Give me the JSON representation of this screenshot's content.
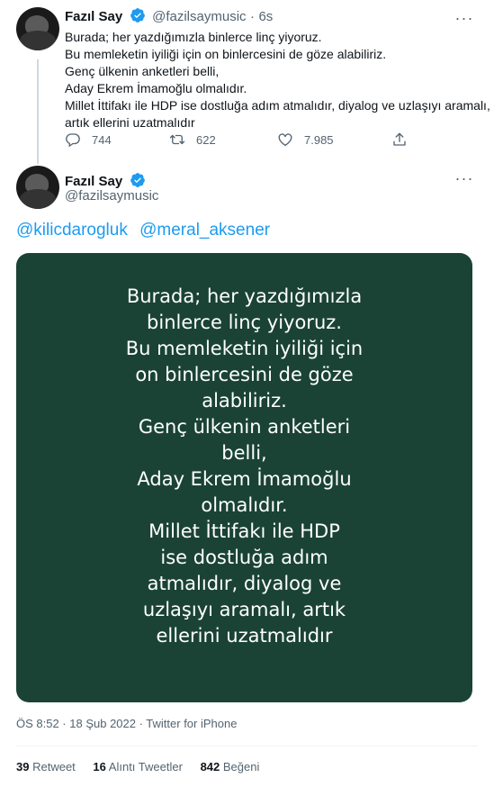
{
  "tweet1": {
    "author_name": "Fazıl Say",
    "handle": "@fazilsaymusic",
    "separator": "·",
    "time": "6s",
    "lines": [
      "Burada; her yazdığımızla binlerce linç yiyoruz.",
      "Bu memleketin iyiliği için on binlercesini de göze alabiliriz.",
      "Genç ülkenin anketleri belli,",
      "Aday Ekrem İmamoğlu olmalıdır.",
      "Millet İttifakı ile HDP ise dostluğa adım atmalıdır, diyalog ve uzlaşıyı aramalı,",
      "artık ellerini uzatmalıdır"
    ],
    "replies": "744",
    "retweets": "622",
    "likes": "7.985"
  },
  "tweet2": {
    "author_name": "Fazıl Say",
    "handle": "@fazilsaymusic",
    "mentions": [
      "@kilicdarogluk",
      "@meral_aksener"
    ],
    "image_lines": [
      "Burada; her yazdığımızla",
      "binlerce linç yiyoruz.",
      "Bu memleketin iyiliği için",
      "on binlercesini de göze",
      "alabiliriz.",
      "Genç ülkenin anketleri",
      "belli,",
      "Aday Ekrem İmamoğlu",
      "olmalıdır.",
      "Millet İttifakı ile HDP",
      "ise dostluğa adım",
      "atmalıdır, diyalog ve",
      "uzlaşıyı aramalı, artık",
      "ellerini uzatmalıdır"
    ],
    "timestamp": "ÖS 8:52 · 18 Şub 2022 · Twitter for iPhone",
    "stats": {
      "retweet_count": "39",
      "retweet_label": "Retweet",
      "quote_count": "16",
      "quote_label": "Alıntı Tweetler",
      "like_count": "842",
      "like_label": "Beğeni"
    }
  },
  "colors": {
    "accent": "#1d9bf0",
    "text": "#0f1419",
    "secondary": "#536471",
    "media_bg": "#1a4336"
  },
  "icons": [
    "verified-badge-icon",
    "more-icon",
    "reply-icon",
    "retweet-icon",
    "like-icon",
    "share-icon"
  ]
}
